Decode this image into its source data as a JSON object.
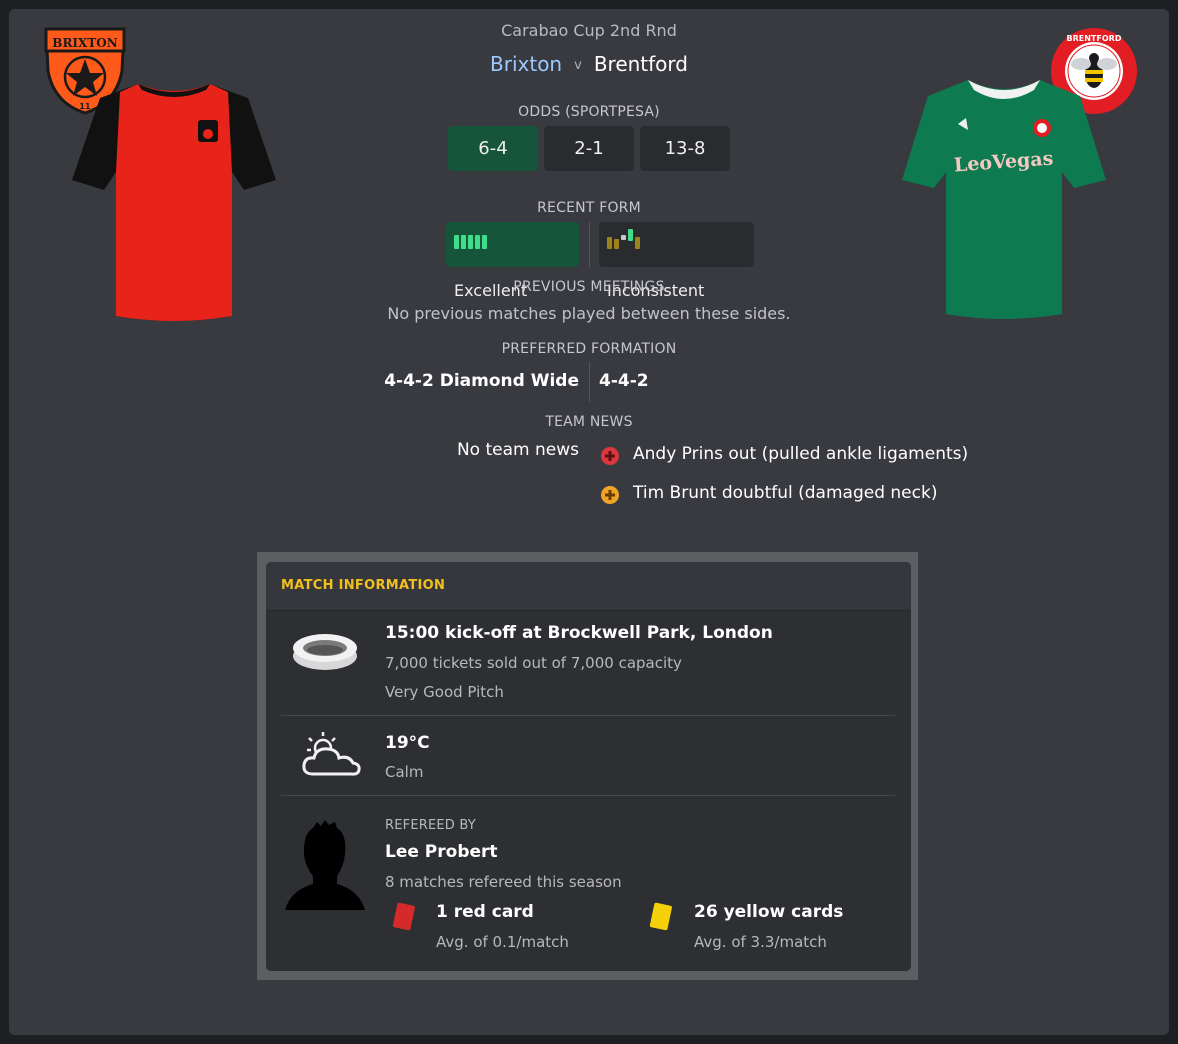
{
  "competition": "Carabao Cup 2nd Rnd",
  "home_team": "Brixton",
  "versus": "v",
  "away_team": "Brentford",
  "home_crest_text": "BRIXTON",
  "away_crest_text": "BRENTFORD",
  "odds": {
    "title": "ODDS (SPORTPESA)",
    "home": "6-4",
    "draw": "2-1",
    "away": "13-8"
  },
  "recent_form": {
    "title": "RECENT FORM",
    "home": "Excellent",
    "away": "Inconsistent"
  },
  "previous_meetings": {
    "title": "PREVIOUS MEETINGS",
    "text": "No previous matches played between these sides."
  },
  "preferred_formation": {
    "title": "PREFERRED FORMATION",
    "home": "4-4-2 Diamond Wide",
    "away": "4-4-2"
  },
  "team_news": {
    "title": "TEAM NEWS",
    "home": "No team news",
    "away": [
      {
        "text": "Andy Prins out (pulled ankle ligaments)",
        "icon": "injury-out-icon"
      },
      {
        "text": "Tim Brunt doubtful (damaged neck)",
        "icon": "injury-doubtful-icon"
      }
    ]
  },
  "match_info": {
    "title": "MATCH INFORMATION",
    "venue": {
      "headline": "15:00 kick-off at Brockwell Park, London",
      "tickets": "7,000 tickets sold out of 7,000 capacity",
      "pitch": "Very Good Pitch"
    },
    "weather": {
      "temp": "19°C",
      "wind": "Calm"
    },
    "referee": {
      "label": "REFEREED BY",
      "name": "Lee Probert",
      "matches": "8 matches refereed this season",
      "red": "1 red card",
      "red_avg": "Avg. of 0.1/match",
      "yellow": "26 yellow cards",
      "yellow_avg": "Avg. of 3.3/match"
    }
  },
  "colors": {
    "highlight_green": "#17553a",
    "home_name": "#9cc9ff",
    "section_gold": "#f2c01e",
    "red_card": "#d42a2a",
    "yellow_card": "#f5d10a"
  }
}
